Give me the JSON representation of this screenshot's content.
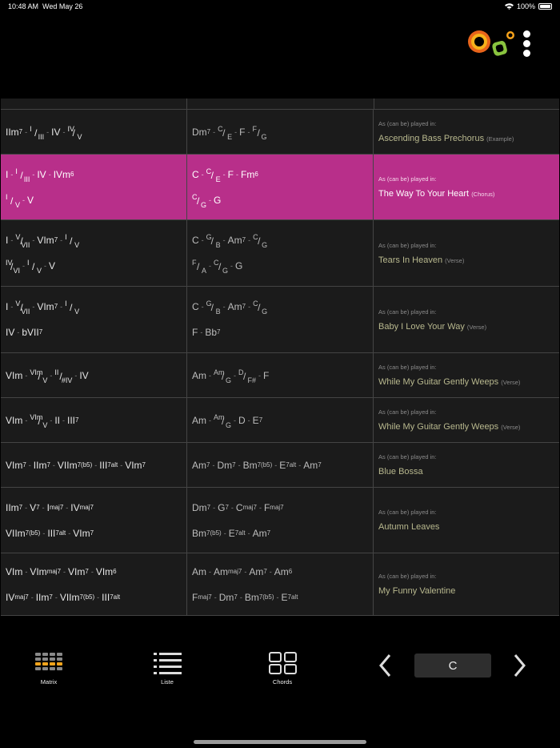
{
  "status": {
    "time": "10:48 AM",
    "date": "Wed May 26",
    "battery": "100%"
  },
  "table": {
    "played_label": "As (can be) played in:",
    "rows": [
      {
        "song": "Ascending Bass Prechorus",
        "note": "(Example)"
      },
      {
        "song": "The Way To Your Heart",
        "note": "(Chorus)"
      },
      {
        "song": "Tears In Heaven",
        "note": "(Verse)"
      },
      {
        "song": "Baby I Love Your Way",
        "note": "(Verse)"
      },
      {
        "song": "While My Guitar Gently Weeps",
        "note": "(Verse)"
      },
      {
        "song": "While My Guitar Gently Weeps",
        "note": "(Verse)"
      },
      {
        "song": "Blue Bossa",
        "note": ""
      },
      {
        "song": "Autumn Leaves",
        "note": ""
      },
      {
        "song": "My Funny Valentine",
        "note": ""
      }
    ]
  },
  "tabs": {
    "matrix": "Matrix",
    "list": "Liste",
    "chords": "Chords"
  },
  "key": {
    "value": "C"
  },
  "colors": {
    "selected_row": "#b82f8a",
    "song_text": "#b8b88e"
  }
}
